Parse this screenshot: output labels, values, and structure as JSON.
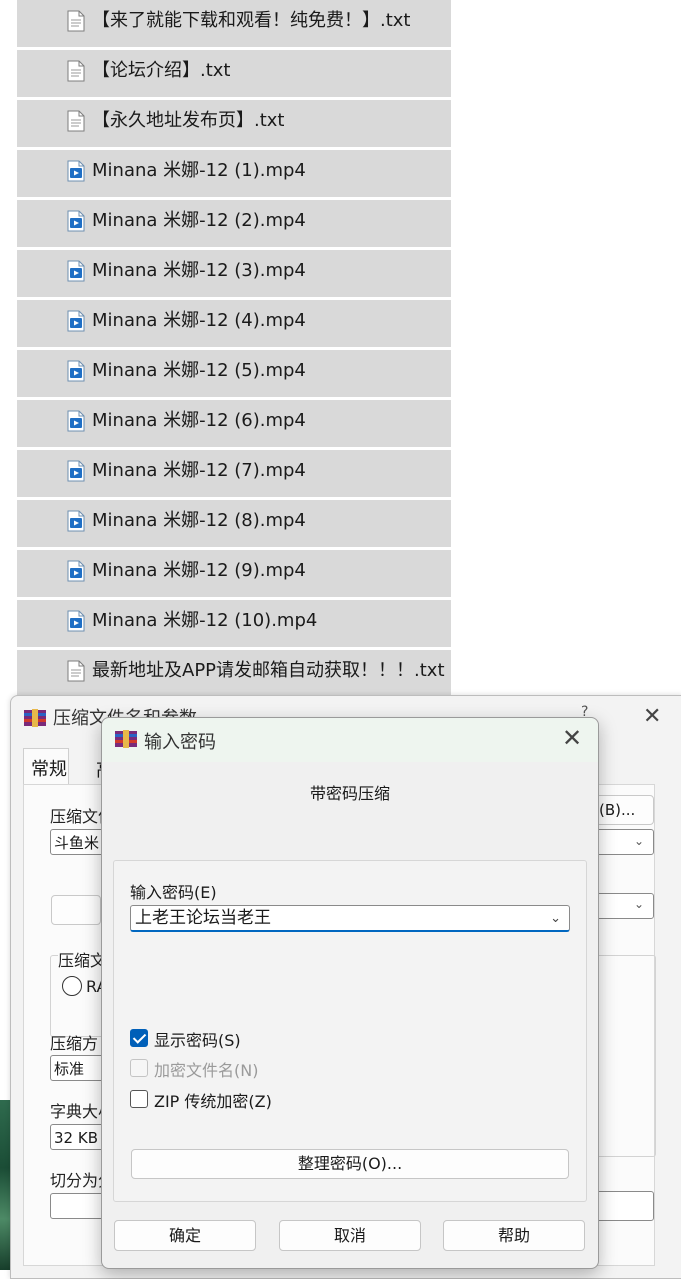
{
  "files": [
    {
      "name": "【来了就能下载和观看！纯免费！】.txt",
      "icon": "text-file-icon"
    },
    {
      "name": "【论坛介绍】.txt",
      "icon": "text-file-icon"
    },
    {
      "name": "【永久地址发布页】.txt",
      "icon": "text-file-icon"
    },
    {
      "name": "Minana 米娜-12 (1).mp4",
      "icon": "video-file-icon"
    },
    {
      "name": "Minana 米娜-12 (2).mp4",
      "icon": "video-file-icon"
    },
    {
      "name": "Minana 米娜-12 (3).mp4",
      "icon": "video-file-icon"
    },
    {
      "name": "Minana 米娜-12 (4).mp4",
      "icon": "video-file-icon"
    },
    {
      "name": "Minana 米娜-12 (5).mp4",
      "icon": "video-file-icon"
    },
    {
      "name": "Minana 米娜-12 (6).mp4",
      "icon": "video-file-icon"
    },
    {
      "name": "Minana 米娜-12 (7).mp4",
      "icon": "video-file-icon"
    },
    {
      "name": "Minana 米娜-12 (8).mp4",
      "icon": "video-file-icon"
    },
    {
      "name": "Minana 米娜-12 (9).mp4",
      "icon": "video-file-icon"
    },
    {
      "name": "Minana 米娜-12 (10).mp4",
      "icon": "video-file-icon"
    },
    {
      "name": "最新地址及APP请发邮箱自动获取！！！.txt",
      "icon": "text-file-icon"
    }
  ],
  "back_dialog": {
    "title": "压缩文件名和参数",
    "help": "?",
    "close": "✕",
    "tab_general": "常规",
    "tab_advanced": "高",
    "archive_name_label": "压缩文件",
    "browse_button": "(B)...",
    "archive_name_value": "斗鱼米",
    "format_group_label": "压缩文",
    "format_rar_label": "RA",
    "method_label": "压缩方",
    "method_value": "标准",
    "dict_label": "字典大小",
    "dict_value": "32 KB",
    "split_label": "切分为分"
  },
  "password_dialog": {
    "title": "输入密码",
    "close": "✕",
    "heading": "带密码压缩",
    "input_label": "输入密码(E)",
    "password_value": "上老王论坛当老王",
    "show_password_label": "显示密码(S)",
    "show_password_checked": true,
    "encrypt_names_label": "加密文件名(N)",
    "encrypt_names_enabled": false,
    "zip_legacy_label": "ZIP 传统加密(Z)",
    "zip_legacy_checked": false,
    "organize_button": "整理密码(O)...",
    "ok_button": "确定",
    "cancel_button": "取消",
    "help_button": "帮助"
  },
  "colors": {
    "accent": "#005fb8",
    "row_bg": "#d9d9d9",
    "dialog_bg": "#f0f0f0"
  }
}
